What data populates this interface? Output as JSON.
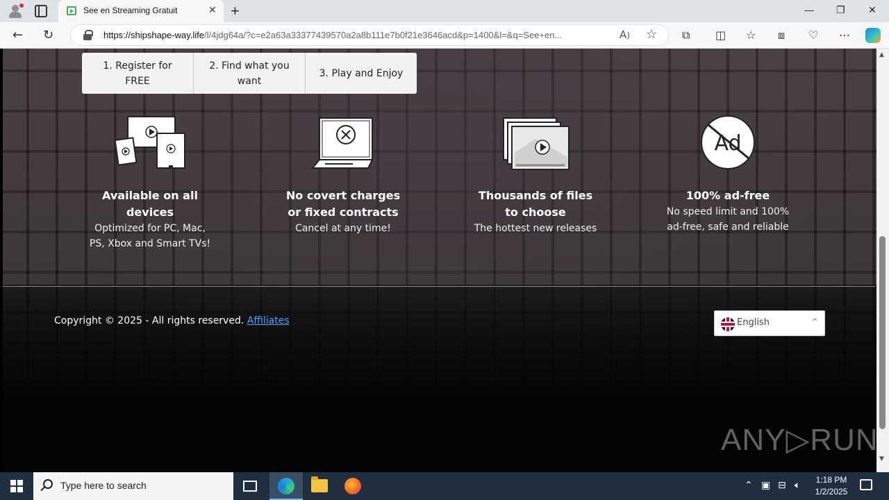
{
  "browser": {
    "tab_title": "See en Streaming Gratuit",
    "url_host": "https://shipshape-way.life",
    "url_rest": "/l/4jdg64a/?c=e2a63a33377439570a2a8b111e7b0f21e3646acd&p=1400&l=&q=See+en..."
  },
  "steps": [
    {
      "label": "1. Register for FREE"
    },
    {
      "label": "2. Find what you want"
    },
    {
      "label": "3. Play and Enjoy"
    }
  ],
  "features": [
    {
      "title": "Available on all devices",
      "desc": "Optimized for PC, Mac, PS, Xbox and Smart TVs!",
      "icon": "devices-icon"
    },
    {
      "title": "No covert charges or fixed contracts",
      "desc": "Cancel at any time!",
      "icon": "laptop-cancel-icon"
    },
    {
      "title": "Thousands of files to choose",
      "desc": "The hottest new releases",
      "icon": "video-stack-icon"
    },
    {
      "title": "100% ad-free",
      "desc": "No speed limit and 100% ad-free, safe and reliable",
      "icon": "no-ads-icon"
    }
  ],
  "icon_text": {
    "ad": "Ad"
  },
  "footer": {
    "copyright": "Copyright © 2025 - All rights reserved.",
    "affiliates": "Affiliates",
    "language": "English"
  },
  "watermark": "ANY▷RUN",
  "taskbar": {
    "search_placeholder": "Type here to search",
    "time": "1:18 PM",
    "date": "1/2/2025"
  }
}
